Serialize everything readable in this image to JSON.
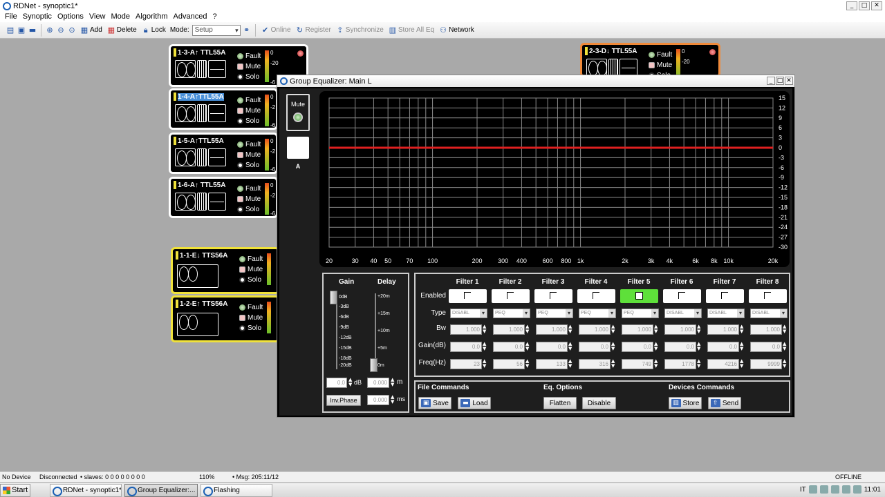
{
  "window": {
    "title": "RDNet - synoptic1*"
  },
  "menu": [
    "File",
    "Synoptic",
    "Options",
    "View",
    "Mode",
    "Algorithm",
    "Advanced",
    "?"
  ],
  "toolbar": {
    "add": "Add",
    "delete": "Delete",
    "lock": "Lock",
    "mode_label": "Mode:",
    "mode_value": "Setup",
    "online": "Online",
    "register": "Register",
    "synchronize": "Synchronize",
    "store_all_eq": "Store All Eq",
    "network": "Network"
  },
  "devices": [
    {
      "id": "1-3-A",
      "title": "1-3-A↑ TTL55A",
      "fault": "Fault",
      "mute": "Mute",
      "solo": "Solo",
      "m0": "0",
      "m1": "-20",
      "m2": "-6"
    },
    {
      "id": "1-4-A",
      "title": "1-4-A↑TTL55A",
      "fault": "Fault",
      "mute": "Mute",
      "solo": "Solo",
      "m0": "0",
      "m1": "-2",
      "m2": "-6"
    },
    {
      "id": "1-5-A",
      "title": "1-5-A↑TTL55A",
      "fault": "Fault",
      "mute": "Mute",
      "solo": "Solo",
      "m0": "0",
      "m1": "-2",
      "m2": "-6"
    },
    {
      "id": "1-6-A",
      "title": "1-6-A↑ TTL55A",
      "fault": "Fault",
      "mute": "Mute",
      "solo": "Solo",
      "m0": "0",
      "m1": "-2",
      "m2": "-6"
    },
    {
      "id": "1-1-E",
      "title": "1-1-E↓ TTS56A",
      "fault": "Fault",
      "mute": "Mute",
      "solo": "Solo",
      "m0": "",
      "m1": "",
      "m2": ""
    },
    {
      "id": "1-2-E",
      "title": "1-2-E↑ TTS56A",
      "fault": "Fault",
      "mute": "Mute",
      "solo": "Solo",
      "m0": "",
      "m1": "",
      "m2": ""
    },
    {
      "id": "2-3-D",
      "title": "2-3-D↓ TTL55A",
      "fault": "Fault",
      "mute": "Mute",
      "solo": "Solo",
      "m0": "0",
      "m1": "-20",
      "m2": ""
    }
  ],
  "eq": {
    "title": "Group Equalizer: Main L",
    "mute_label": "Mute",
    "a_label": "A",
    "graph": {
      "y_ticks": [
        "15",
        "12",
        "9",
        "6",
        "3",
        "0",
        "-3",
        "-6",
        "-9",
        "-12",
        "-15",
        "-18",
        "-21",
        "-24",
        "-27",
        "-30"
      ],
      "x_ticks": [
        "20",
        "30",
        "40",
        "50",
        "70",
        "100",
        "200",
        "300",
        "400",
        "600",
        "800",
        "1k",
        "2k",
        "3k",
        "4k",
        "6k",
        "8k",
        "10k",
        "20k"
      ],
      "curve_db": 0
    },
    "gain_delay": {
      "gain_label": "Gain",
      "delay_label": "Delay",
      "gain_ticks": [
        "0dB",
        "-3dB",
        "-6dB",
        "-9dB",
        "-12dB",
        "-15dB",
        "-18dB",
        "-20dB"
      ],
      "delay_ticks": [
        "+20m",
        "+15m",
        "+10m",
        "+5m",
        "0m"
      ],
      "gain_value": "0.0",
      "gain_unit": "dB",
      "delay_m_value": "0.000",
      "delay_m_unit": "m",
      "delay_ms_value": "0.000",
      "delay_ms_unit": "ms",
      "inv_phase": "Inv.Phase"
    },
    "filters": {
      "row_labels": {
        "enabled": "Enabled",
        "type": "Type",
        "bw": "Bw",
        "gain": "Gain(dB)",
        "freq": "Freq(Hz)"
      },
      "items": [
        {
          "name": "Filter 1",
          "enabled": false,
          "type": "DISABL",
          "bw": "1.000",
          "gain": "0.0",
          "freq": "23"
        },
        {
          "name": "Filter 2",
          "enabled": false,
          "type": "PEQ",
          "bw": "1.000",
          "gain": "0.0",
          "freq": "56"
        },
        {
          "name": "Filter 3",
          "enabled": false,
          "type": "PEQ",
          "bw": "1.000",
          "gain": "0.0",
          "freq": "133"
        },
        {
          "name": "Filter 4",
          "enabled": false,
          "type": "PEQ",
          "bw": "1.000",
          "gain": "0.0",
          "freq": "316"
        },
        {
          "name": "Filter 5",
          "enabled": true,
          "type": "PEQ",
          "bw": "1.000",
          "gain": "0.0",
          "freq": "749"
        },
        {
          "name": "Filter 6",
          "enabled": false,
          "type": "DISABL",
          "bw": "1.000",
          "gain": "0.0",
          "freq": "1778"
        },
        {
          "name": "Filter 7",
          "enabled": false,
          "type": "DISABL",
          "bw": "1.000",
          "gain": "0.0",
          "freq": "4216"
        },
        {
          "name": "Filter 8",
          "enabled": false,
          "type": "DISABL",
          "bw": "1.000",
          "gain": "0.0",
          "freq": "9999"
        }
      ]
    },
    "commands": {
      "file_label": "File Commands",
      "save": "Save",
      "load": "Load",
      "eq_label": "Eq. Options",
      "flatten": "Flatten",
      "disable": "Disable",
      "dev_label": "Devices Commands",
      "store": "Store",
      "send": "Send"
    }
  },
  "status": {
    "device": "No Device",
    "connection": "Disconnected",
    "slaves": "• slaves:  0  0  0  0  0  0  0  0",
    "zoom": "110%",
    "msg": "• Msg:   205:11/12",
    "state": "OFFLINE"
  },
  "taskbar": {
    "start": "Start",
    "tasks": [
      "RDNet - synoptic1*",
      "Group Equalizer:...",
      "Flashing"
    ],
    "lang": "IT",
    "clock": "11:01"
  }
}
